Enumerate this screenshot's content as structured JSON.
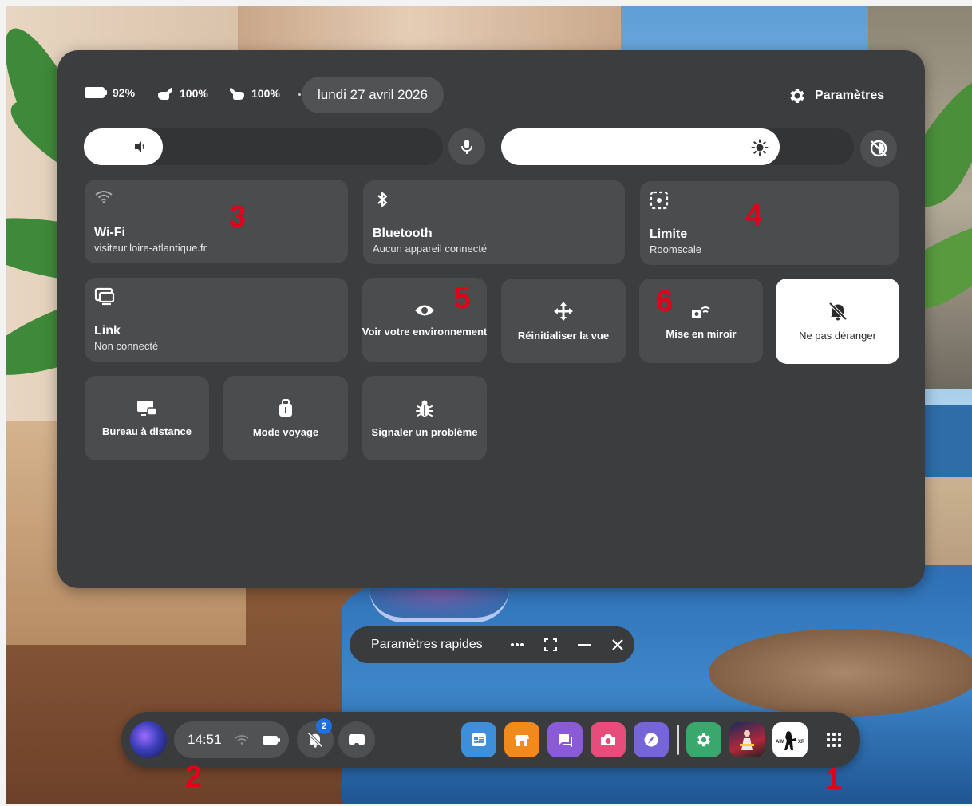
{
  "status": {
    "headset_battery": "92%",
    "left_controller_battery": "100%",
    "right_controller_battery": "100%",
    "date": "lundi 27 avril 2026",
    "settings_label": "Paramètres"
  },
  "sliders": {
    "volume": {
      "level": 0.22
    },
    "brightness": {
      "level": 0.79
    }
  },
  "tiles": {
    "wifi": {
      "title": "Wi-Fi",
      "subtitle": "visiteur.loire-atlantique.fr"
    },
    "bluetooth": {
      "title": "Bluetooth",
      "subtitle": "Aucun appareil connecté"
    },
    "boundary": {
      "title": "Limite",
      "subtitle": "Roomscale"
    },
    "link": {
      "title": "Link",
      "subtitle": "Non connecté"
    },
    "passthrough": {
      "label": "Voir votre environnement"
    },
    "reset_view": {
      "label": "Réinitialiser la vue"
    },
    "cast": {
      "label": "Mise en miroir"
    },
    "dnd": {
      "label": "Ne pas déranger",
      "active": true
    },
    "remote_desktop": {
      "label": "Bureau à distance"
    },
    "travel_mode": {
      "label": "Mode voyage"
    },
    "report_problem": {
      "label": "Signaler un problème"
    }
  },
  "markers": [
    "1",
    "2",
    "3",
    "4",
    "5",
    "6"
  ],
  "window": {
    "title": "Paramètres rapides"
  },
  "taskbar": {
    "time": "14:51",
    "notification_count": "2"
  },
  "colors": {
    "panel": "#3c3d3f",
    "tile": "#4b4c4e",
    "active_tile": "#ffffff",
    "marker": "#e3001b",
    "badge": "#1e6fe0"
  }
}
